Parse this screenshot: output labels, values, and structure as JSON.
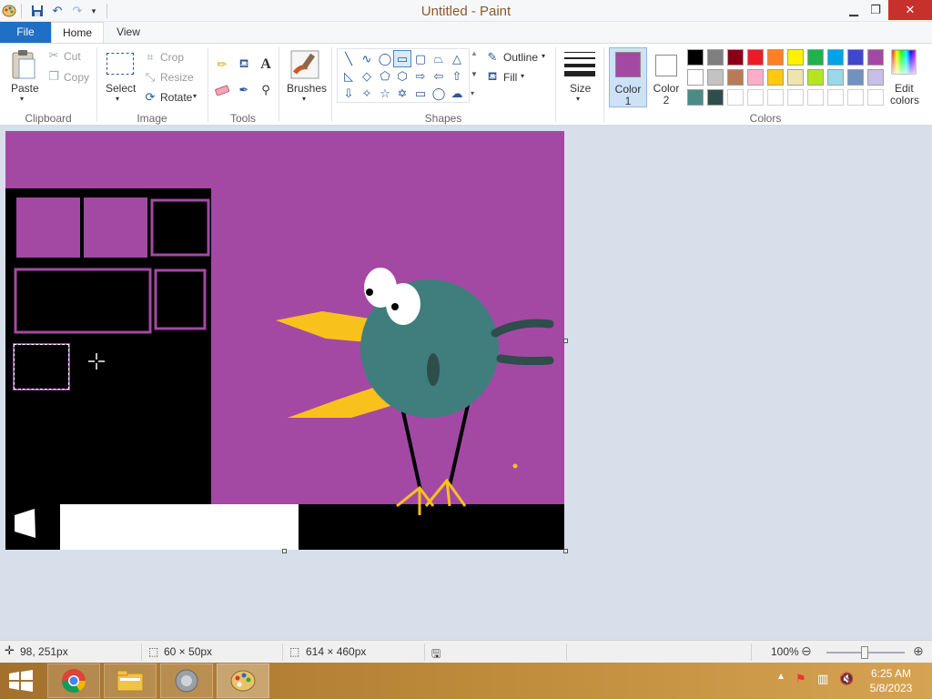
{
  "window": {
    "title": "Untitled - Paint"
  },
  "tabs": {
    "file": "File",
    "home": "Home",
    "view": "View"
  },
  "clipboard": {
    "paste": "Paste",
    "cut": "Cut",
    "copy": "Copy",
    "label": "Clipboard"
  },
  "image": {
    "select": "Select",
    "crop": "Crop",
    "resize": "Resize",
    "rotate": "Rotate",
    "label": "Image"
  },
  "tools": {
    "label": "Tools",
    "text_icon": "A"
  },
  "brushes": {
    "label": "Brushes"
  },
  "shapes": {
    "outline": "Outline",
    "fill": "Fill",
    "label": "Shapes"
  },
  "size": {
    "label": "Size"
  },
  "colors": {
    "color1": "Color",
    "color1_num": "1",
    "color2": "Color",
    "color2_num": "2",
    "edit1": "Edit",
    "edit2": "colors",
    "label": "Colors",
    "color1_value": "#a349a4",
    "color2_value": "#ffffff",
    "palette_row1": [
      "#000000",
      "#7f7f7f",
      "#880015",
      "#ed1c24",
      "#ff7f27",
      "#fff200",
      "#22b14c",
      "#00a2e8",
      "#3f48cc",
      "#a349a4"
    ],
    "palette_row2": [
      "#ffffff",
      "#c3c3c3",
      "#b97a57",
      "#ffaec9",
      "#ffc90e",
      "#efe4b0",
      "#b5e61d",
      "#99d9ea",
      "#7092be",
      "#c8bfe7"
    ],
    "palette_row3": [
      "#4a8b87",
      "#2e4d4b"
    ]
  },
  "status": {
    "cursor_pos": "98, 251px",
    "selection_size": "60 × 50px",
    "canvas_size": "614 × 460px",
    "zoom": "100%"
  },
  "taskbar": {
    "time": "6:25 AM",
    "date": "5/8/2023"
  }
}
